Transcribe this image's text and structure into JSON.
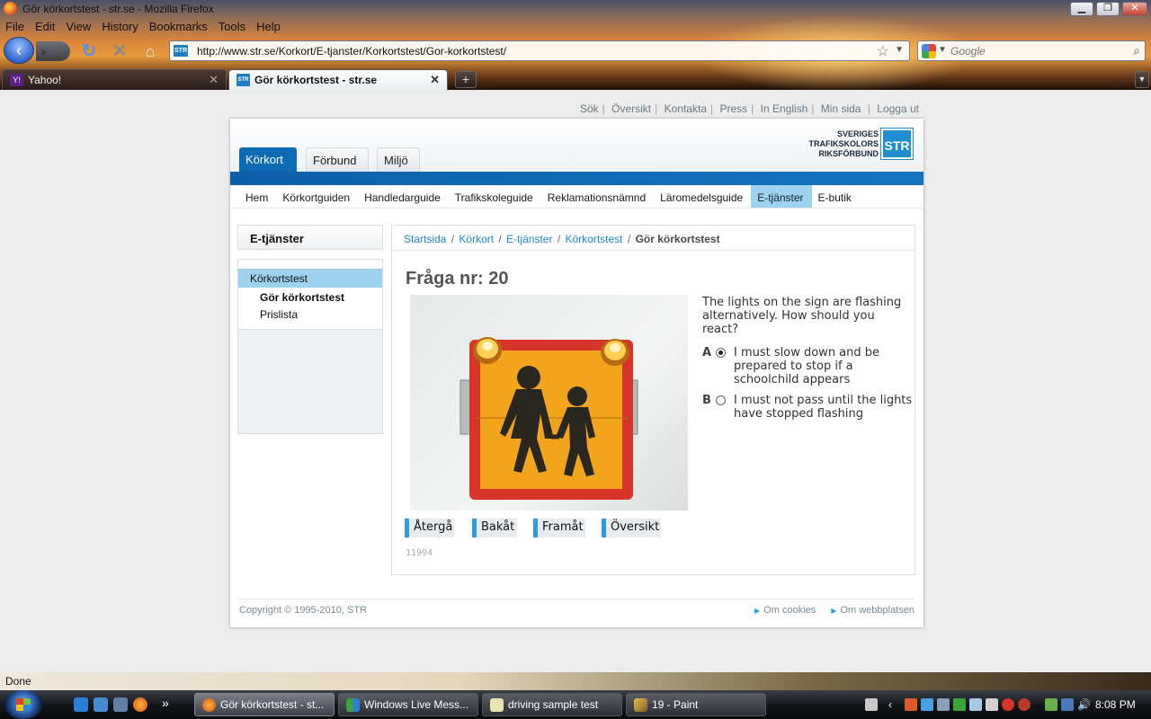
{
  "window": {
    "title": "Gör körkortstest - str.se - Mozilla Firefox",
    "min": "▁",
    "max": "❐",
    "close": "✕"
  },
  "menubar": [
    "File",
    "Edit",
    "View",
    "History",
    "Bookmarks",
    "Tools",
    "Help"
  ],
  "navbar": {
    "url": "http://www.str.se/Korkort/E-tjanster/Korkortstest/Gor-korkortstest/",
    "search_placeholder": "Google",
    "favicon_text": "STR"
  },
  "tabs": [
    {
      "label": "Yahoo!",
      "icon": "Y!",
      "close": "✕"
    },
    {
      "label": "Gör körkortstest - str.se",
      "icon": "STR",
      "close": "✕"
    }
  ],
  "newtab": "+",
  "alltabs": "▼",
  "site": {
    "toplinks": [
      "Sök",
      "Översikt",
      "Kontakta",
      "Press",
      "In English",
      "Min sida",
      "Logga ut"
    ],
    "main_tabs": [
      "Körkort",
      "Förbund",
      "Miljö"
    ],
    "logo": {
      "line1": "SVERIGES",
      "line2": "TRAFIKSKOLORS",
      "line3": "RIKSFÖRBUND",
      "mark": "STR"
    },
    "subnav": [
      "Hem",
      "Körkortguiden",
      "Handledarguide",
      "Trafikskoleguide",
      "Reklamationsnämnd",
      "Läromedelsguide",
      "E-tjänster",
      "E-butik"
    ],
    "subnav_active": "E-tjänster",
    "sidebar": {
      "heading": "E-tjänster",
      "items": [
        "Körkortstest",
        "Gör körkortstest",
        "Prislista"
      ]
    },
    "breadcrumb": [
      "Startsida",
      "Körkort",
      "E-tjänster",
      "Körkortstest"
    ],
    "breadcrumb_sep": "/",
    "breadcrumb_current": "Gör körkortstest",
    "question": {
      "title": "Fråga nr: 20",
      "text": "The lights on the sign are flashing alternatively. How should you react?",
      "options": [
        {
          "letter": "A",
          "text": "I must slow down and be prepared to stop if a schoolchild appears",
          "selected": true
        },
        {
          "letter": "B",
          "text": "I must not pass until the lights have stopped flashing",
          "selected": false
        }
      ],
      "buttons": [
        "Återgå",
        "Bakåt",
        "Framåt",
        "Översikt"
      ],
      "id": "11994"
    },
    "footer": {
      "copyright": "Copyright © 1995-2010, STR",
      "links": [
        "Om cookies",
        "Om webbplatsen"
      ],
      "link_arrow": "▶"
    }
  },
  "statusbar": "Done",
  "taskbar": {
    "buttons": [
      "Gör körkortstest - st...",
      "Windows Live Mess...",
      "driving sample test",
      "19 - Paint"
    ],
    "quicklaunch_more": "»",
    "clock": "8:08 PM"
  },
  "colors": {
    "brand_blue": "#0d6bb3",
    "link_blue": "#1d87c9",
    "active_nav": "#9fd2ee",
    "sign_orange": "#f2a51c",
    "sign_red": "#d8352a"
  }
}
